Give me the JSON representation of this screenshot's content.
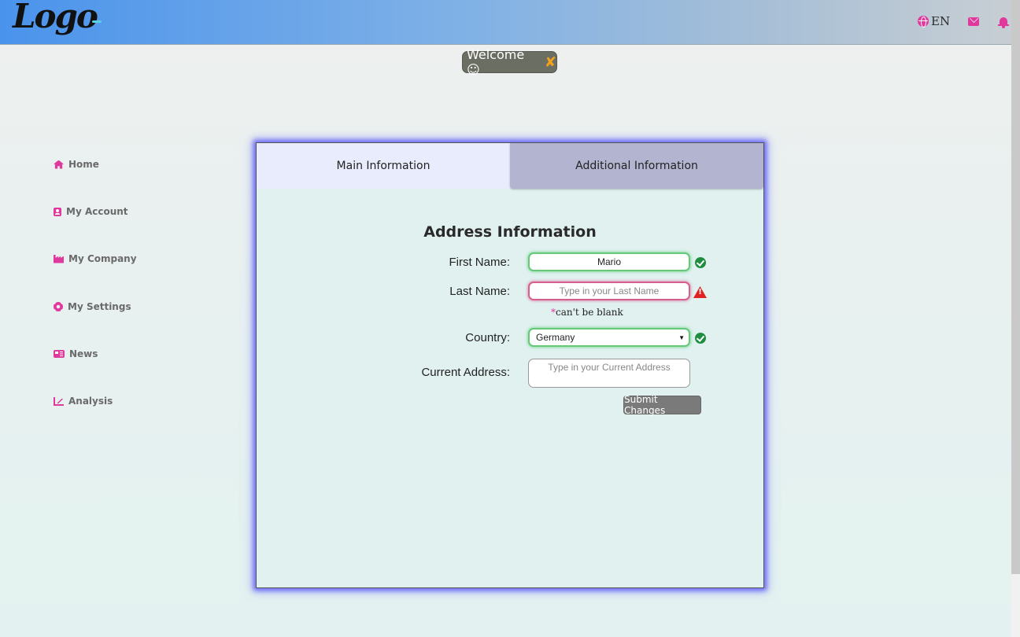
{
  "header": {
    "logo_text": "Logo",
    "language": "EN",
    "icons": [
      "globe-icon",
      "envelope-icon",
      "bell-icon"
    ],
    "accent_color": "#e0399e"
  },
  "welcome": {
    "text": "Welcome ☺",
    "close": "✘"
  },
  "sidebar": {
    "items": [
      {
        "label": "Home",
        "icon": "home-icon"
      },
      {
        "label": "My Account",
        "icon": "account-card-icon"
      },
      {
        "label": "My Company",
        "icon": "industry-icon"
      },
      {
        "label": "My Settings",
        "icon": "gear-icon"
      },
      {
        "label": "News",
        "icon": "newspaper-icon"
      },
      {
        "label": "Analysis",
        "icon": "line-chart-icon"
      }
    ]
  },
  "panel": {
    "tabs": [
      {
        "label": "Main Information",
        "active": true
      },
      {
        "label": "Additional Information",
        "active": false
      }
    ],
    "form": {
      "title": "Address Information",
      "first_name": {
        "label": "First Name:",
        "value": "Mario",
        "placeholder": "",
        "status": "valid"
      },
      "last_name": {
        "label": "Last Name:",
        "value": "",
        "placeholder": "Type in your Last Name",
        "status": "invalid",
        "error_star": "*",
        "error": "can't be blank"
      },
      "country": {
        "label": "Country:",
        "value": "Germany",
        "status": "valid"
      },
      "address": {
        "label": "Current Address:",
        "value": "",
        "placeholder": "Type in your Current Address"
      },
      "submit": "Submit Changes"
    }
  }
}
